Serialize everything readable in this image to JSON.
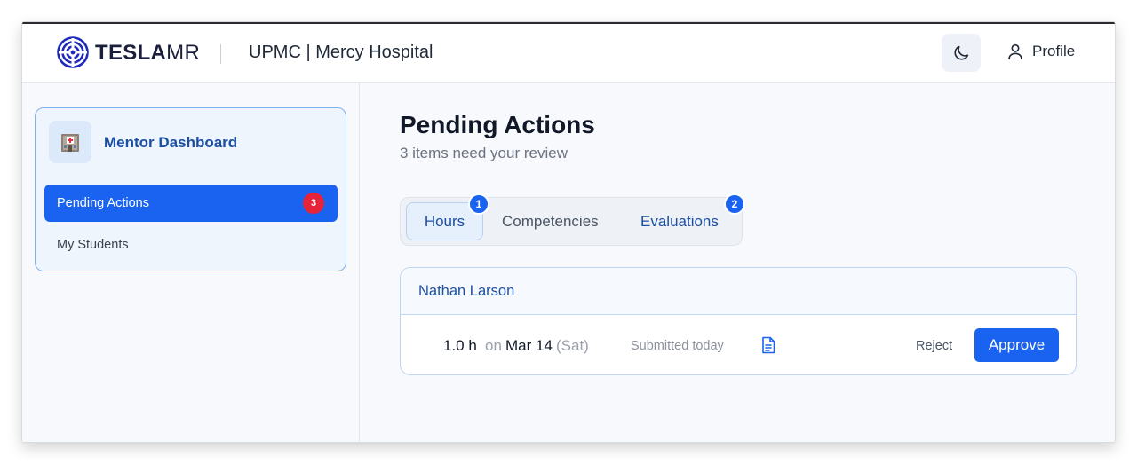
{
  "header": {
    "brand_bold": "TESLA",
    "brand_light": "MR",
    "organization": "UPMC | Mercy Hospital",
    "theme_icon": "moon-icon",
    "profile_label": "Profile"
  },
  "sidebar": {
    "title": "Mentor Dashboard",
    "icon": "hospital-icon",
    "items": [
      {
        "label": "Pending Actions",
        "badge": "3",
        "active": true
      },
      {
        "label": "My Students",
        "active": false
      }
    ]
  },
  "main": {
    "title": "Pending Actions",
    "subtitle": "3 items need your review",
    "tabs": [
      {
        "label": "Hours",
        "badge": "1",
        "selected": true
      },
      {
        "label": "Competencies"
      },
      {
        "label": "Evaluations",
        "badge": "2"
      }
    ],
    "student": {
      "name": "Nathan Larson",
      "entry": {
        "hours": "1.0 h",
        "on": "on",
        "date": "Mar 14",
        "day": "(Sat)",
        "submitted": "Submitted today",
        "reject_label": "Reject",
        "approve_label": "Approve"
      }
    }
  },
  "colors": {
    "accent": "#1a63f0",
    "badge_red": "#e5233b",
    "link_blue": "#1c4fa3"
  }
}
